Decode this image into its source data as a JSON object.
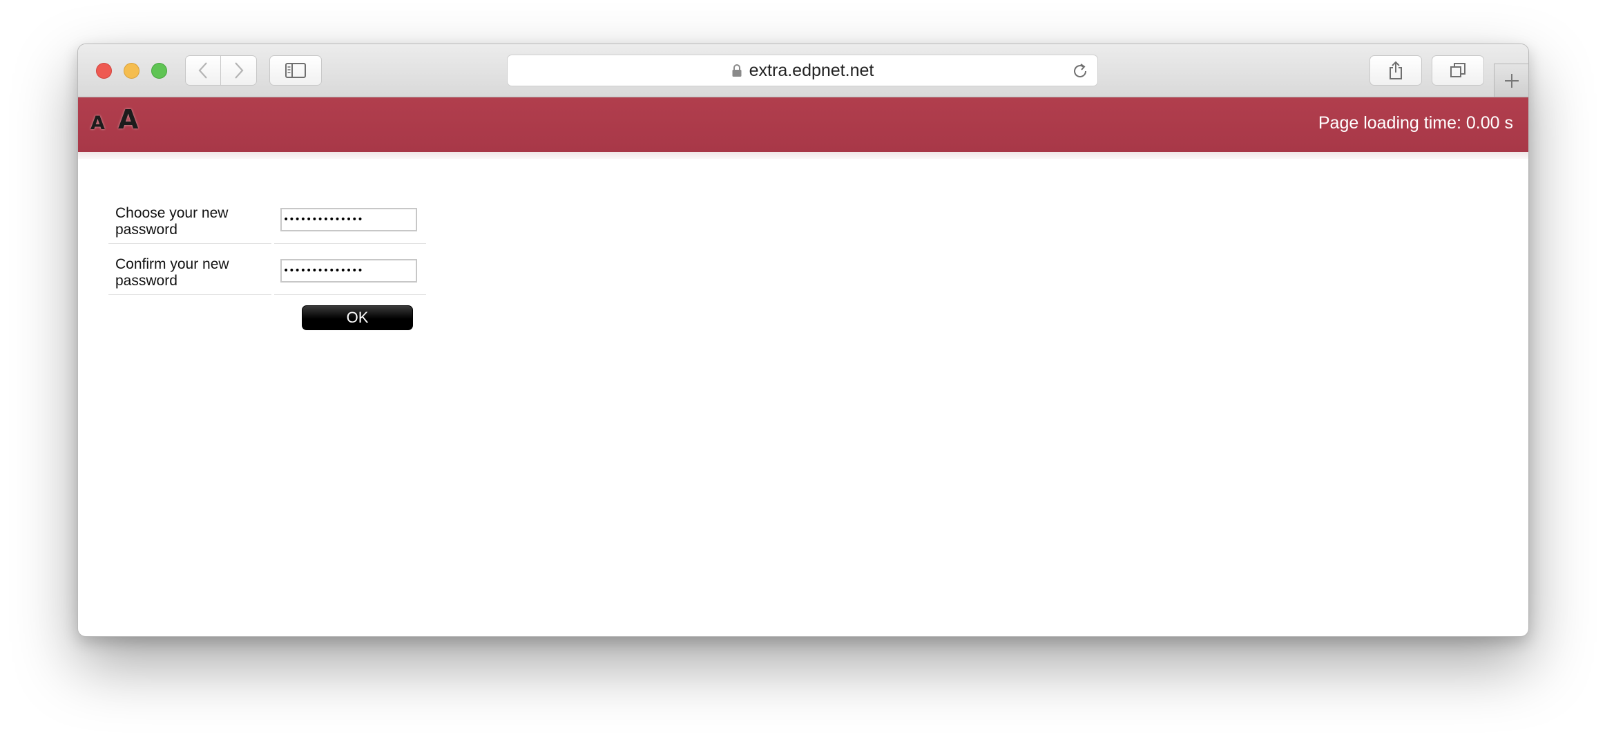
{
  "browser": {
    "address": "extra.edpnet.net"
  },
  "header": {
    "font_small": "A",
    "font_large": "A",
    "load_time": "Page loading time: 0.00 s",
    "background_color": "#ad3b4a"
  },
  "form": {
    "new_password_label": "Choose your new password",
    "confirm_password_label": "Confirm your new password",
    "new_password_value": "••••••••••••••",
    "confirm_password_value": "••••••••••••••",
    "ok_label": "OK"
  }
}
